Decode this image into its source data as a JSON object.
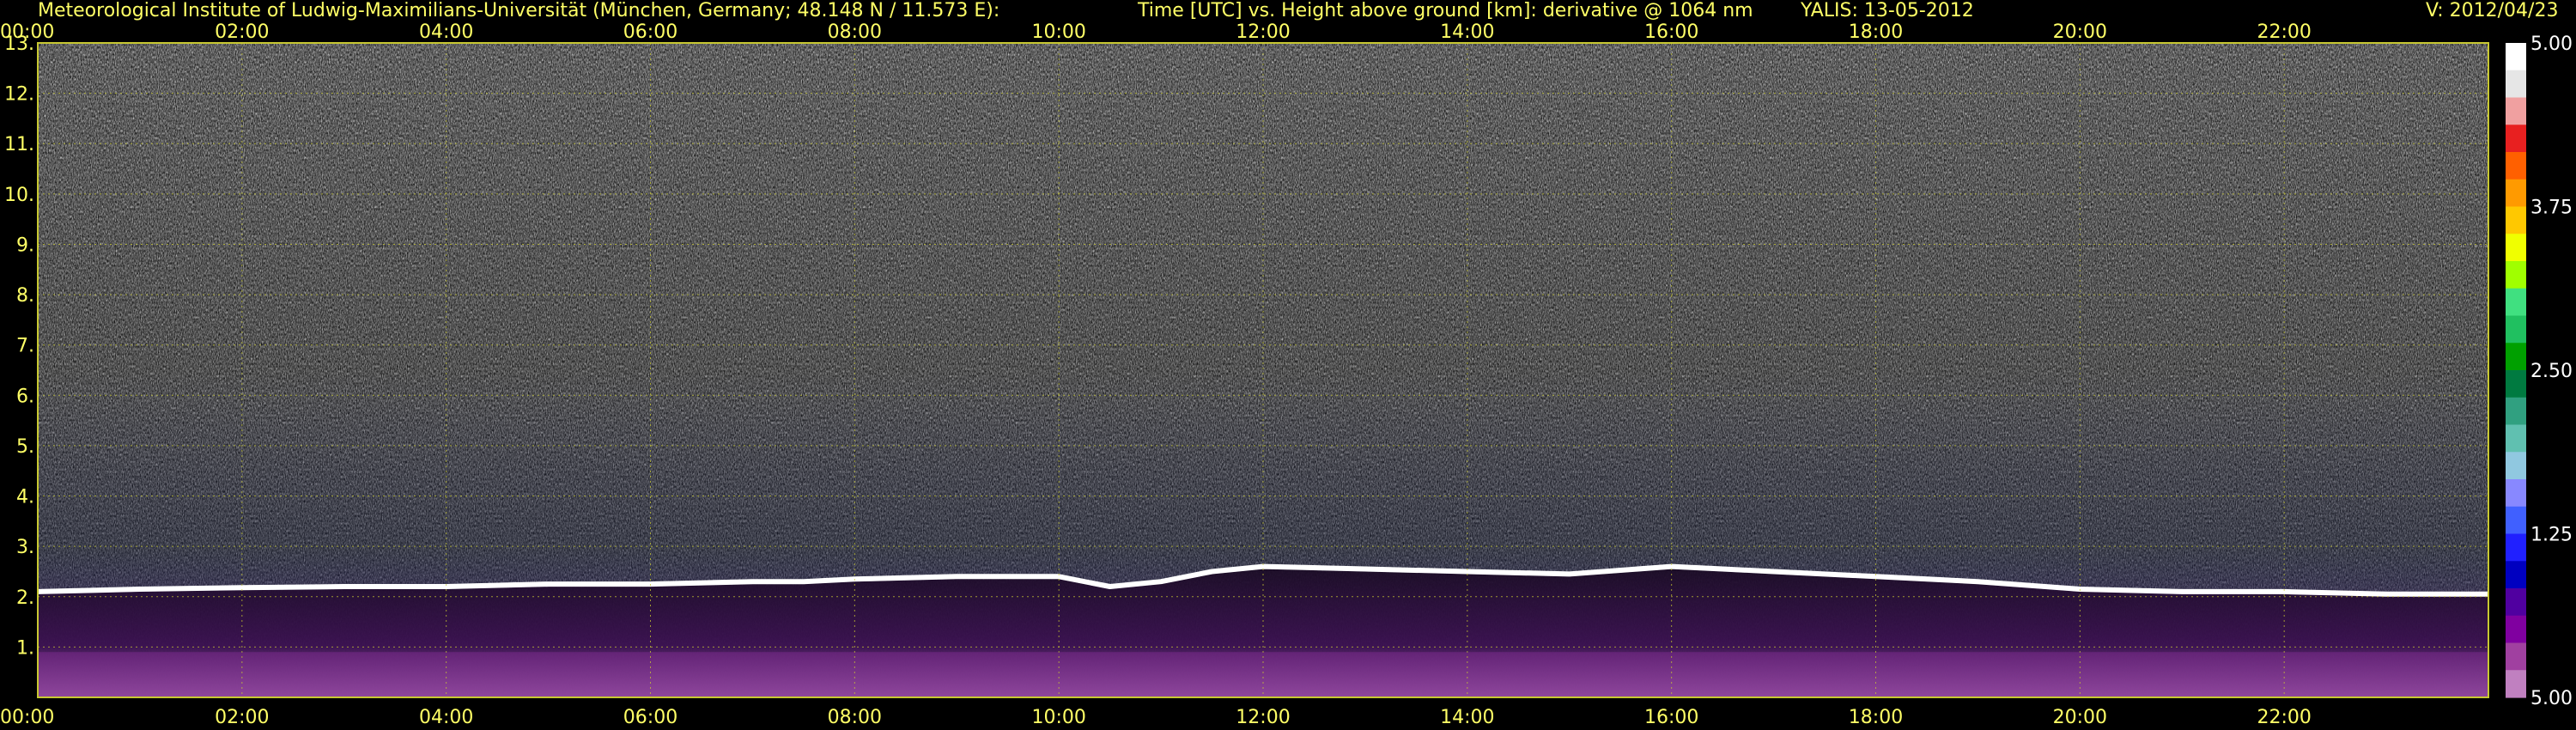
{
  "header": {
    "institute": "Meteorological Institute of Ludwig-Maximilians-Universität (München, Germany; 48.148 N / 11.573 E):",
    "title": "Time [UTC] vs. Height above ground [km]: derivative @ 1064 nm",
    "station": "YALIS: 13-05-2012",
    "version": "V: 2012/04/23"
  },
  "colors": {
    "label": "#ffff66",
    "grid": "#c8c832",
    "background": "#000000",
    "layer_white": "#ffffff",
    "boundary_layer": "#7a2a8c",
    "colorbar_labels": "#ffffff"
  },
  "chart_data": {
    "type": "heatmap",
    "title": "Time [UTC] vs. Height above ground [km]: derivative @ 1064 nm",
    "xlabel": "Time [UTC]",
    "ylabel": "Height above ground [km]",
    "x_ticks": [
      "00:00",
      "02:00",
      "04:00",
      "06:00",
      "08:00",
      "10:00",
      "12:00",
      "14:00",
      "16:00",
      "18:00",
      "20:00",
      "22:00"
    ],
    "y_ticks": [
      1,
      2,
      3,
      4,
      5,
      6,
      7,
      8,
      9,
      10,
      11,
      12,
      13
    ],
    "xlim_hours": [
      0,
      24
    ],
    "ylim_km": [
      0,
      13
    ],
    "grid": true,
    "colorbar": {
      "labels": [
        "5.00",
        "3.75",
        "2.50",
        "1.25",
        "5.00"
      ],
      "colors": [
        "#ffffff",
        "#e6e6e6",
        "#f0a0a0",
        "#e82020",
        "#ff6000",
        "#ff9a00",
        "#ffc800",
        "#f0ff00",
        "#a0ff00",
        "#40e080",
        "#20c060",
        "#00a000",
        "#007a40",
        "#30a080",
        "#60c0b0",
        "#90c8e0",
        "#8888ff",
        "#4060ff",
        "#2020ff",
        "#0000c0",
        "#5000a0",
        "#8000a0",
        "#a040a0",
        "#c080c0"
      ]
    },
    "layer_top_km": {
      "hours": [
        0,
        1,
        2,
        3,
        4,
        5,
        6,
        7,
        7.5,
        8,
        9,
        10,
        10.5,
        11,
        11.5,
        12,
        13,
        14,
        15,
        16,
        16.5,
        17,
        18,
        19,
        20,
        21,
        22,
        23,
        24
      ],
      "heights": [
        2.1,
        2.15,
        2.18,
        2.2,
        2.2,
        2.25,
        2.25,
        2.3,
        2.3,
        2.35,
        2.4,
        2.4,
        2.2,
        2.3,
        2.5,
        2.6,
        2.55,
        2.5,
        2.45,
        2.6,
        2.55,
        2.5,
        2.4,
        2.3,
        2.15,
        2.1,
        2.1,
        2.05,
        2.05
      ]
    }
  }
}
